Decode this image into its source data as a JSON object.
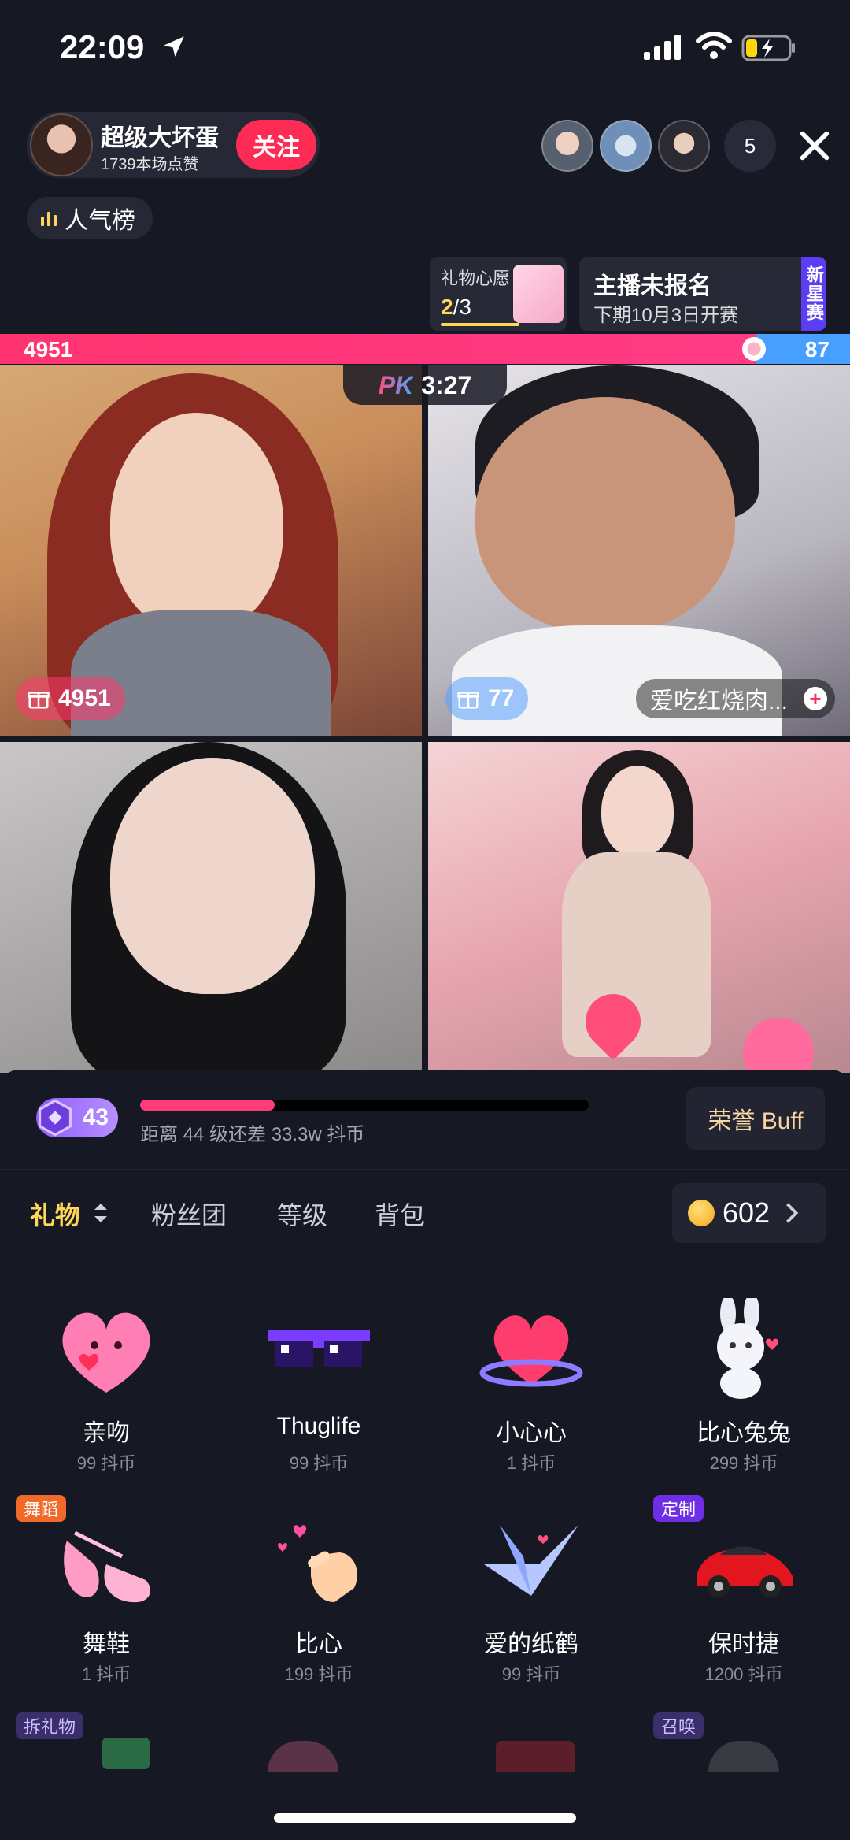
{
  "status_bar": {
    "time": "22:09"
  },
  "host": {
    "name": "超级大坏蛋",
    "likes": "1739本场点赞",
    "follow_label": "关注"
  },
  "viewers": {
    "count": "5"
  },
  "rank": {
    "label": "人气榜"
  },
  "wish": {
    "title": "礼物心愿",
    "current": "2",
    "total": "/3"
  },
  "new_star": {
    "title": "主播未报名",
    "subtitle": "下期10月3日开赛",
    "tag": "新星赛"
  },
  "pk": {
    "left_score": "4951",
    "right_score": "87",
    "logo": "PK",
    "timer": "3:27",
    "left_fraction": 0.89
  },
  "streams": [
    {
      "gift_score": "4951"
    },
    {
      "gift_score": "77",
      "name": "爱吃红烧肉..."
    }
  ],
  "panel": {
    "level": "43",
    "exp_text": "距离 44 级还差 33.3w 抖币",
    "exp_fraction": 0.3,
    "buff_label": "荣誉 Buff",
    "tabs": [
      "礼物",
      "粉丝团",
      "等级",
      "背包"
    ],
    "coins": "602"
  },
  "gifts": [
    {
      "name": "亲吻",
      "price": "99 抖币",
      "icon": "kiss-heart-icon"
    },
    {
      "name": "Thuglife",
      "price": "99 抖币",
      "icon": "pixel-sunglasses-icon"
    },
    {
      "name": "小心心",
      "price": "1 抖币",
      "icon": "heart-ring-icon"
    },
    {
      "name": "比心兔兔",
      "price": "299 抖币",
      "icon": "bunny-icon"
    },
    {
      "name": "舞鞋",
      "price": "1 抖币",
      "icon": "ballet-shoes-icon",
      "tag": "舞蹈"
    },
    {
      "name": "比心",
      "price": "199 抖币",
      "icon": "finger-heart-icon"
    },
    {
      "name": "爱的纸鹤",
      "price": "99 抖币",
      "icon": "paper-crane-icon"
    },
    {
      "name": "保时捷",
      "price": "1200 抖币",
      "icon": "sports-car-icon",
      "tag": "定制"
    }
  ],
  "row3_tags": [
    "拆礼物",
    "召唤"
  ],
  "colors": {
    "accent": "#fe2c55",
    "tab_active": "#ffd55a",
    "pk_red": "#ff3370",
    "pk_blue": "#47a0ff"
  }
}
